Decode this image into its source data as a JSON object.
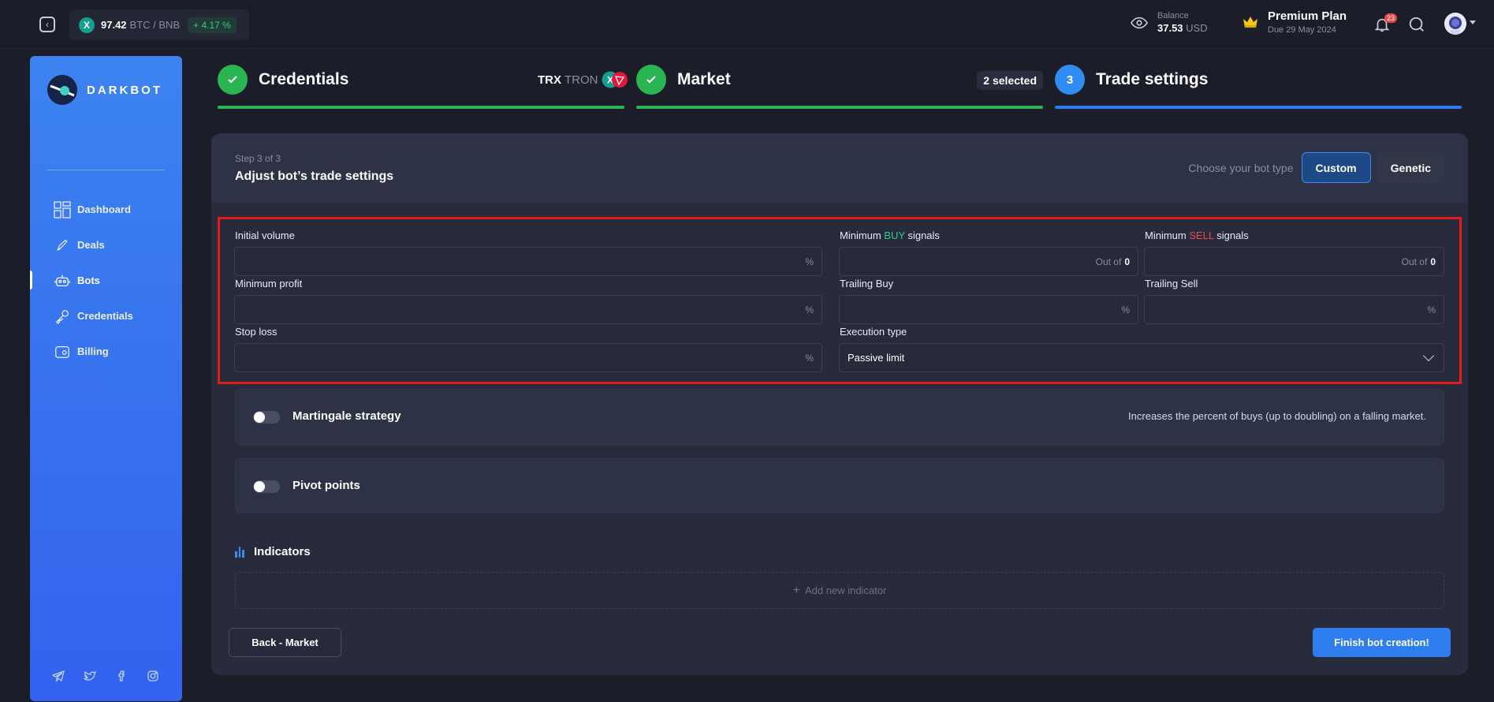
{
  "header": {
    "ticker": {
      "coin_letter": "X",
      "price": "97.42",
      "pair": "BTC / BNB",
      "change": "+ 4.17 %"
    },
    "balance": {
      "label": "Balance",
      "amount": "37.53",
      "currency": "USD"
    },
    "plan": {
      "name": "Premium Plan",
      "due": "Due 29 May 2024"
    },
    "notifications_count": "23"
  },
  "sidebar": {
    "logo_text": "DARKBOT",
    "items": [
      {
        "label": "Dashboard",
        "icon": "dashboard-icon"
      },
      {
        "label": "Deals",
        "icon": "rocket-icon"
      },
      {
        "label": "Bots",
        "icon": "robot-icon",
        "active": true
      },
      {
        "label": "Credentials",
        "icon": "key-icon"
      },
      {
        "label": "Billing",
        "icon": "wallet-icon"
      }
    ],
    "socials": [
      "telegram-icon",
      "twitter-icon",
      "facebook-icon",
      "instagram-icon"
    ]
  },
  "stepper": {
    "steps": [
      {
        "number": "1",
        "title": "Credentials",
        "status": "done",
        "extra_symbol": "TRX",
        "extra_name": "TRON"
      },
      {
        "number": "2",
        "title": "Market",
        "status": "done",
        "extra": "2 selected"
      },
      {
        "number": "3",
        "title": "Trade settings",
        "status": "current"
      }
    ]
  },
  "card": {
    "step_label": "Step 3 of 3",
    "title": "Adjust bot’s trade settings",
    "bot_type_label": "Choose your bot type",
    "bot_types": [
      "Custom",
      "Genetic"
    ],
    "selected_bot_type": "Custom"
  },
  "form": {
    "initial_volume": {
      "label": "Initial volume",
      "suffix": "%",
      "value": ""
    },
    "min_buy": {
      "label_pre": "Minimum ",
      "label_hl": "BUY",
      "label_post": " signals",
      "out_of_label": "Out of",
      "out_of_value": "0",
      "value": ""
    },
    "min_sell": {
      "label_pre": "Minimum ",
      "label_hl": "SELL",
      "label_post": " signals",
      "out_of_label": "Out of",
      "out_of_value": "0",
      "value": ""
    },
    "min_profit": {
      "label": "Minimum profit",
      "suffix": "%",
      "value": ""
    },
    "trailing_buy": {
      "label": "Trailing Buy",
      "suffix": "%",
      "value": ""
    },
    "trailing_sell": {
      "label": "Trailing Sell",
      "suffix": "%",
      "value": ""
    },
    "stop_loss": {
      "label": "Stop loss",
      "suffix": "%",
      "value": ""
    },
    "execution_type": {
      "label": "Execution type",
      "value": "Passive limit"
    }
  },
  "options": {
    "martingale": {
      "title": "Martingale strategy",
      "description": "Increases the percent of buys (up to doubling) on a falling market.",
      "enabled": false
    },
    "pivot": {
      "title": "Pivot points",
      "enabled": false
    }
  },
  "indicators": {
    "title": "Indicators",
    "add_label": "Add new indicator"
  },
  "footer": {
    "back_label": "Back - Market",
    "finish_label": "Finish bot creation!"
  },
  "colors": {
    "accent": "#2f7ef0",
    "success": "#2bb552",
    "buy": "#36c98d",
    "sell": "#e94d4d",
    "highlight_frame": "#e31b1b"
  }
}
